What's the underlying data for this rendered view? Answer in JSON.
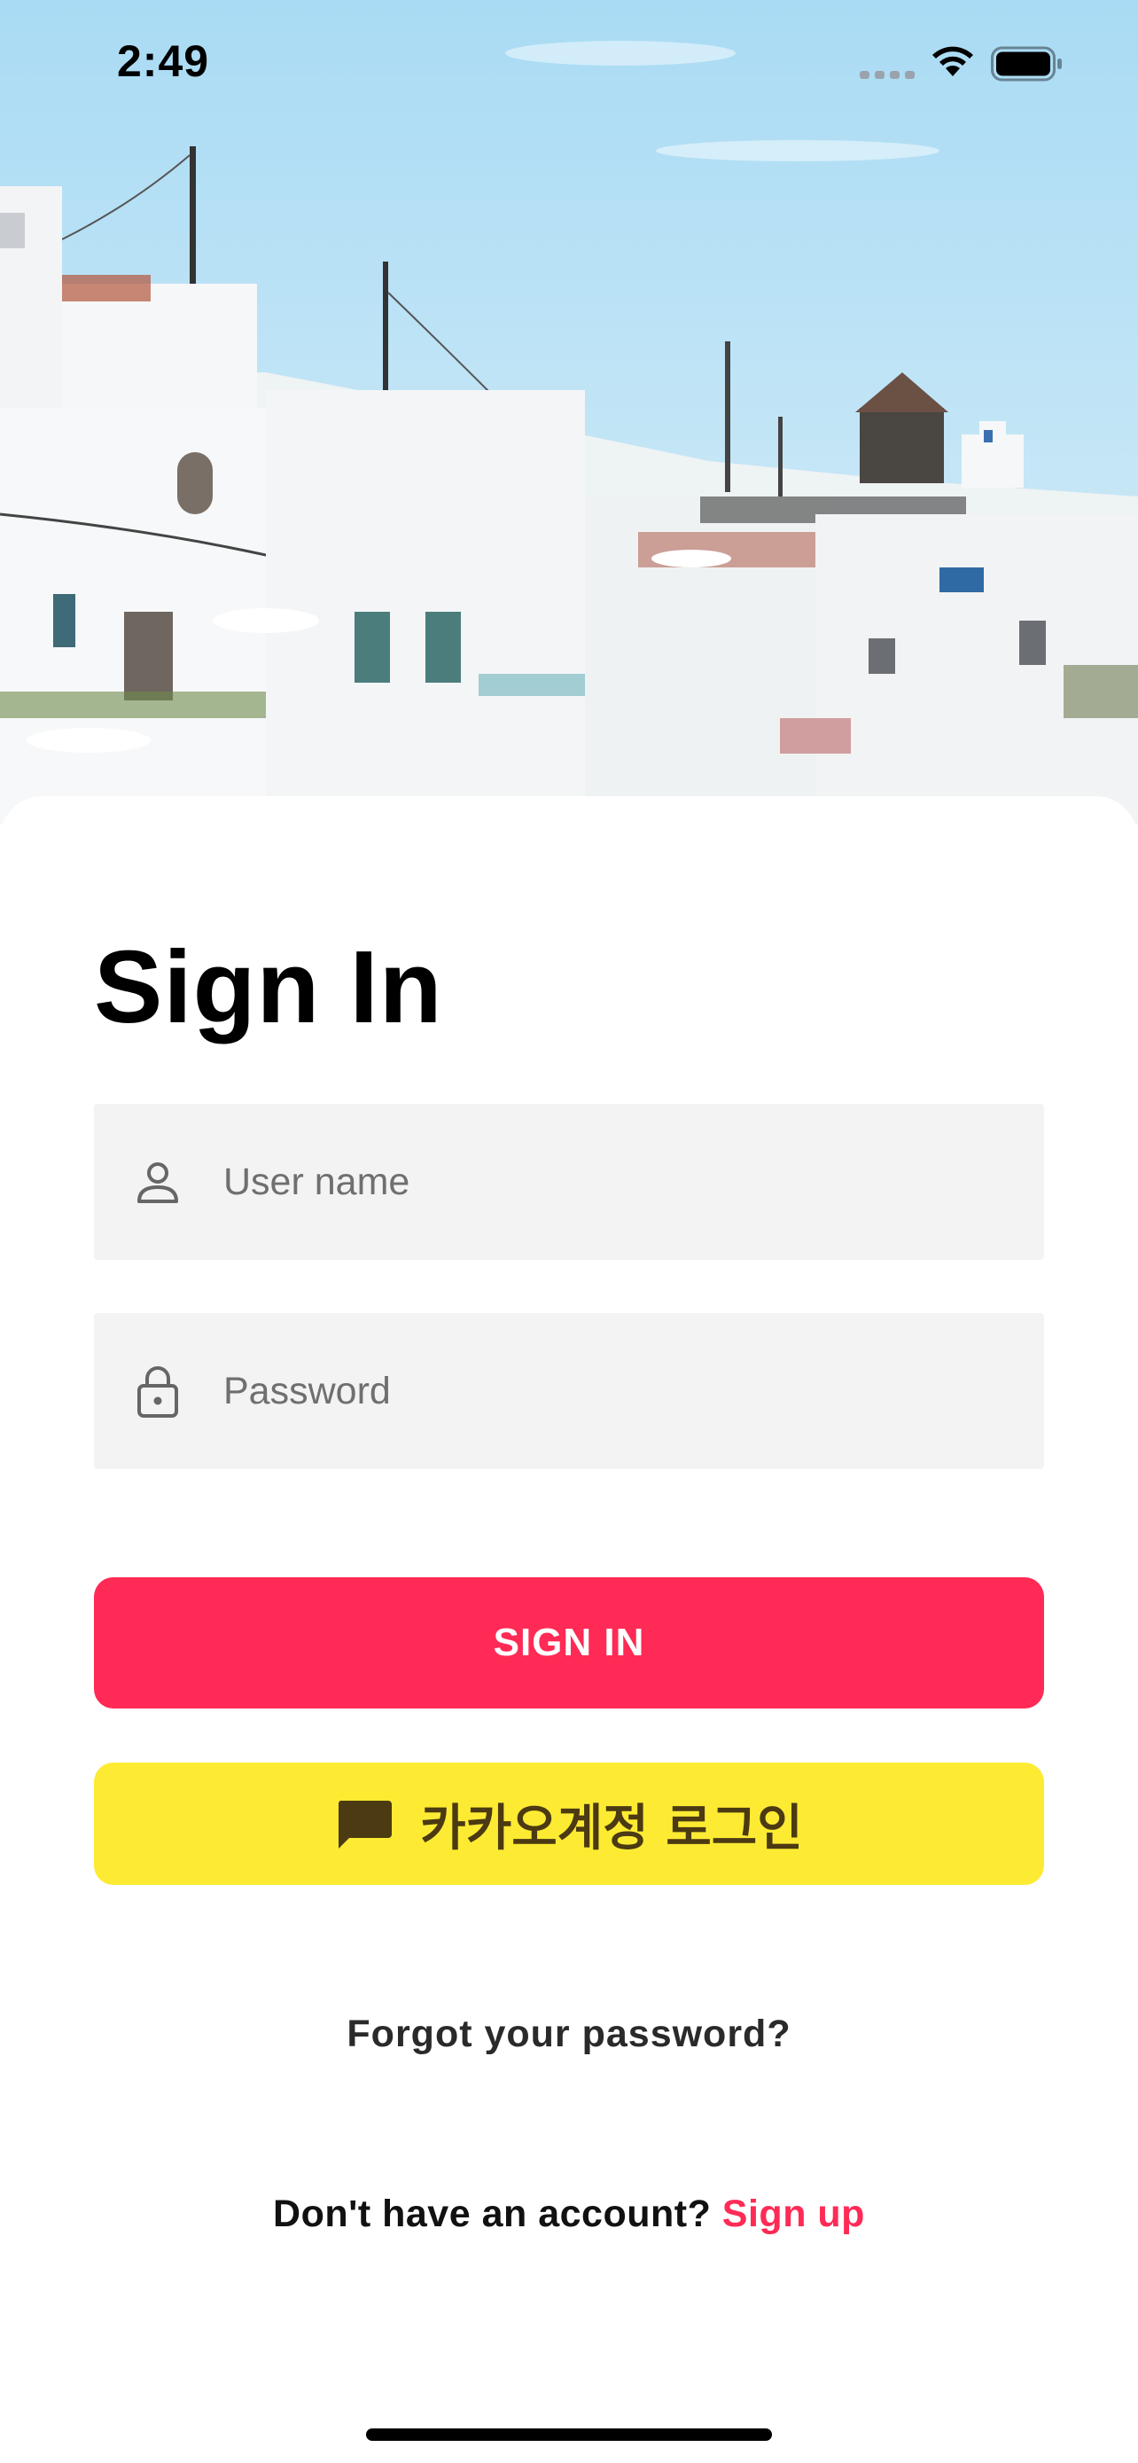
{
  "status_bar": {
    "time": "2:49",
    "icons": [
      "cellular-signal-icon",
      "wifi-icon",
      "battery-icon"
    ]
  },
  "hero": {
    "image": "photo-of-white-hillside-village-by-the-sea"
  },
  "sign_in": {
    "title": "Sign In",
    "username": {
      "placeholder": "User name",
      "value": "",
      "icon": "person-icon"
    },
    "password": {
      "placeholder": "Password",
      "value": "",
      "icon": "lock-icon"
    },
    "sign_in_button": "SIGN IN",
    "kakao_button": {
      "label": "카카오계정 로그인",
      "icon": "chat-bubble-icon"
    },
    "forgot_password": "Forgot your password?",
    "no_account_text": "Don't have an account?",
    "sign_up_link": "Sign up"
  },
  "colors": {
    "accent": "#ff2a55",
    "kakao_yellow": "#fdeb33",
    "kakao_text": "#4b3a12",
    "field_background": "#f3f3f3",
    "placeholder": "#6f6f6f"
  }
}
